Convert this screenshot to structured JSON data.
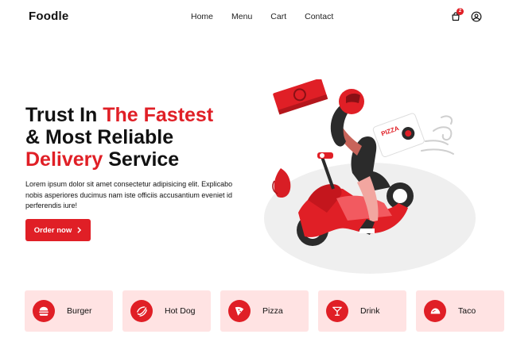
{
  "brand": {
    "name": "Foodle",
    "accent": "#e01f26",
    "accent_light": "#ffe3e3"
  },
  "nav": {
    "links": [
      "Home",
      "Menu",
      "Cart",
      "Contact"
    ],
    "cart_icon": "shopping-bag-icon",
    "cart_count": "2",
    "user_icon": "user-circle-icon"
  },
  "hero": {
    "title_line1_black": "Trust In ",
    "title_line1_red": "The Fastest",
    "title_line2": "& Most Reliable",
    "title_line3_red": "Delivery",
    "title_line3_black": " Service",
    "description": "Lorem ipsum dolor sit amet consectetur adipisicing elit. Explicabo nobis asperiores ducimus nam iste officiis accusantium eveniet id perferendis iure!",
    "cta_label": "Order now",
    "cta_icon": "chevron-right-icon",
    "illustration_box_text": "PIZZA"
  },
  "categories": [
    {
      "label": "Burger",
      "icon": "burger-icon"
    },
    {
      "label": "Hot Dog",
      "icon": "hot-dog-icon"
    },
    {
      "label": "Pizza",
      "icon": "pizza-icon"
    },
    {
      "label": "Drink",
      "icon": "cocktail-icon"
    },
    {
      "label": "Taco",
      "icon": "taco-icon"
    }
  ]
}
